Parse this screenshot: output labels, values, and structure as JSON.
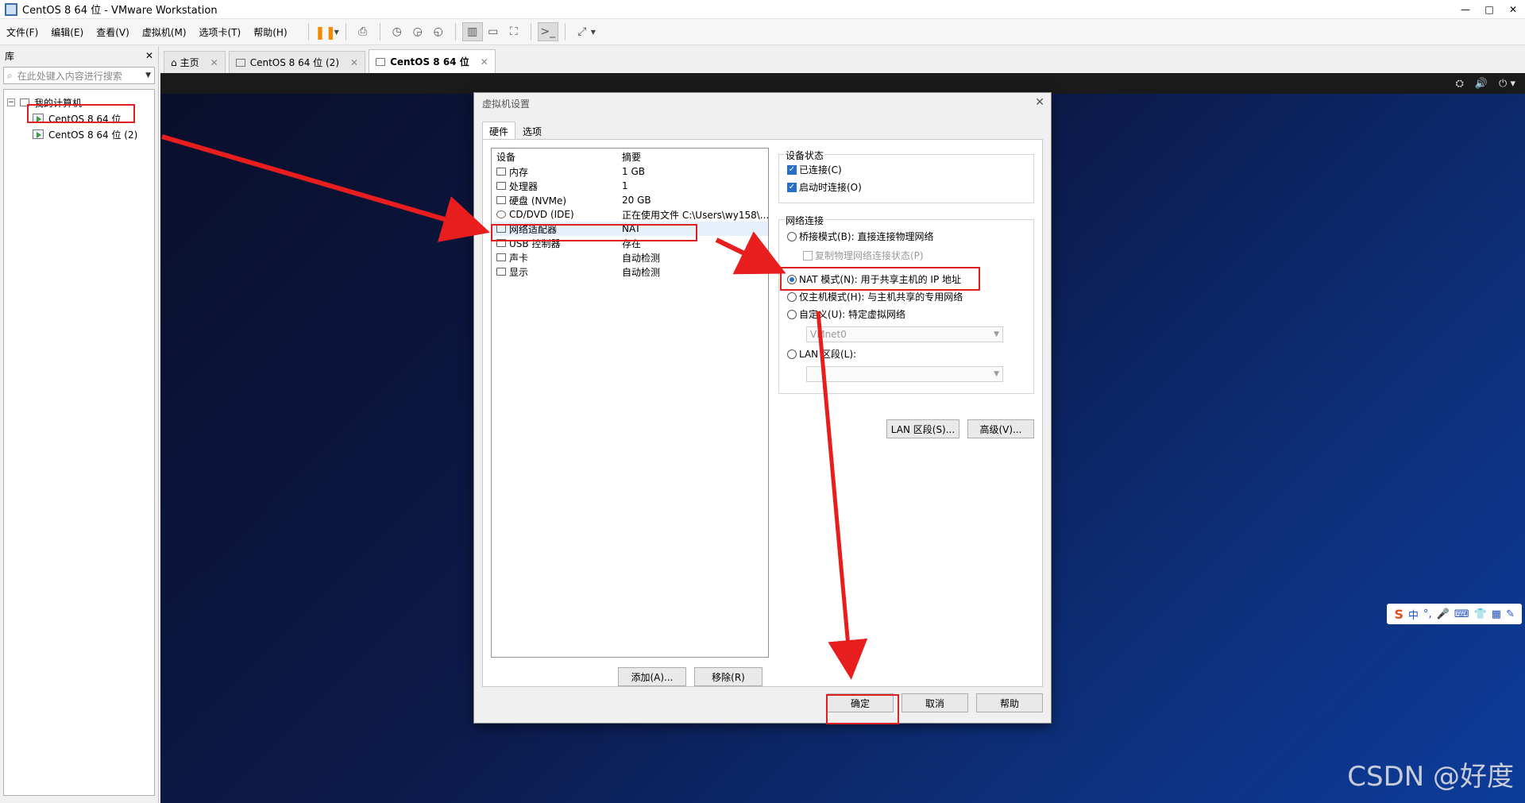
{
  "window": {
    "title": "CentOS 8 64 位 - VMware Workstation",
    "controls": [
      "—",
      "□",
      "✕"
    ]
  },
  "menu": [
    "文件(F)",
    "编辑(E)",
    "查看(V)",
    "虚拟机(M)",
    "选项卡(T)",
    "帮助(H)"
  ],
  "library": {
    "title": "库",
    "close": "✕",
    "search_placeholder": "在此处键入内容进行搜索",
    "root": "我的计算机",
    "items": [
      "CentOS 8 64 位",
      "CentOS 8 64 位 (2)"
    ]
  },
  "tabs": [
    {
      "label": "主页",
      "active": false
    },
    {
      "label": "CentOS 8 64 位 (2)",
      "active": false
    },
    {
      "label": "CentOS 8 64 位",
      "active": true
    }
  ],
  "dialog": {
    "title": "虚拟机设置",
    "close": "✕",
    "tabs": [
      "硬件",
      "选项"
    ],
    "device_header": {
      "device": "设备",
      "summary": "摘要"
    },
    "devices": [
      {
        "name": "内存",
        "summary": "1 GB"
      },
      {
        "name": "处理器",
        "summary": "1"
      },
      {
        "name": "硬盘 (NVMe)",
        "summary": "20 GB"
      },
      {
        "name": "CD/DVD (IDE)",
        "summary": "正在使用文件 C:\\Users\\wy158\\..."
      },
      {
        "name": "网络适配器",
        "summary": "NAT"
      },
      {
        "name": "USB 控制器",
        "summary": "存在"
      },
      {
        "name": "声卡",
        "summary": "自动检测"
      },
      {
        "name": "显示",
        "summary": "自动检测"
      }
    ],
    "add_button": "添加(A)...",
    "remove_button": "移除(R)",
    "device_status": {
      "label": "设备状态",
      "connected": "已连接(C)",
      "connect_on_power": "启动时连接(O)"
    },
    "network": {
      "label": "网络连接",
      "bridged": "桥接模式(B): 直接连接物理网络",
      "replicate": "复制物理网络连接状态(P)",
      "nat": "NAT 模式(N): 用于共享主机的 IP 地址",
      "host_only": "仅主机模式(H): 与主机共享的专用网络",
      "custom": "自定义(U): 特定虚拟网络",
      "vmnet_value": "VMnet0",
      "lan": "LAN 区段(L):",
      "lan_value": ""
    },
    "lan_segments_button": "LAN 区段(S)...",
    "advanced_button": "高级(V)...",
    "ok_button": "确定",
    "cancel_button": "取消",
    "help_button": "帮助"
  },
  "ime": {
    "logo": "S",
    "items": [
      "中",
      "°,",
      "🎤",
      "⌨",
      "👕",
      "▦",
      "✎"
    ]
  },
  "watermark": "CSDN @好度",
  "colors": {
    "highlight": "#e02020",
    "accent": "#2a6fc7",
    "pause": "#f08a00"
  }
}
